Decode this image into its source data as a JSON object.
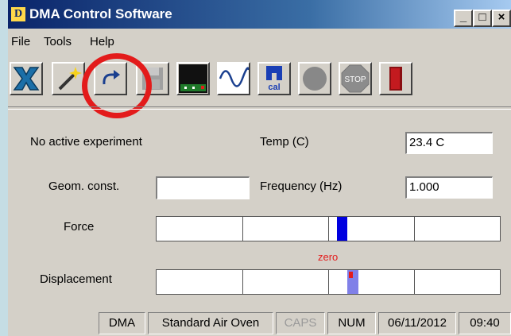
{
  "window": {
    "title": "DMA Control Software",
    "app_icon": "DMA-app-icon"
  },
  "window_controls": {
    "minimize": "_",
    "maximize": "□",
    "close": "×"
  },
  "menu": [
    {
      "label": "File",
      "mnemonic": "F"
    },
    {
      "label": "Tools",
      "mnemonic": "T"
    },
    {
      "label": "Help",
      "mnemonic": "H"
    }
  ],
  "toolbar": [
    {
      "icon": "x-logo-icon"
    },
    {
      "icon": "magic-wand-icon"
    },
    {
      "icon": "redo-arrow-icon"
    },
    {
      "icon": "save-disk-icon"
    },
    {
      "icon": "monitor-display-icon"
    },
    {
      "icon": "sine-wave-icon"
    },
    {
      "icon": "calibration-icon",
      "text": "cal"
    },
    {
      "icon": "record-circle-icon"
    },
    {
      "icon": "stop-sign-icon",
      "text": "STOP"
    },
    {
      "icon": "exit-door-icon"
    }
  ],
  "annotation": {
    "color": "#e31b1b"
  },
  "status_panel": {
    "experiment_status": "No active experiment",
    "temp_label": "Temp (C)",
    "temp_value": "23.4 C",
    "geom_label": "Geom. const.",
    "geom_value": "",
    "frequency_label": "Frequency (Hz)",
    "frequency_value": "1.000",
    "force_label": "Force",
    "force_level": 0.525,
    "zero_label": "zero",
    "displacement_label": "Displacement",
    "displacement_level": 0.555
  },
  "statusbar": {
    "mode": "DMA",
    "oven": "Standard Air Oven",
    "caps": "CAPS",
    "num": "NUM",
    "date": "06/11/2012",
    "time": "09:40"
  },
  "colors": {
    "force_bar": "#0000e0",
    "displacement_bar": "#8080e8",
    "displacement_marker": "#e31b1b",
    "caps_text": "#9a9a9a"
  }
}
